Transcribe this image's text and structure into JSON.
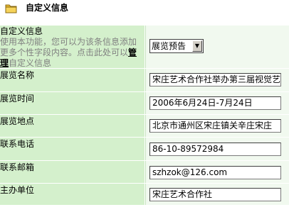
{
  "header": {
    "title": "自定义信息",
    "icon": "folder-icon"
  },
  "custom_info": {
    "label": "自定义信息",
    "desc_before": "使用本功能，您可以为该条信息添加更多个性字段内容。点击此处可以",
    "desc_link": "管理",
    "desc_after": "自定义信息",
    "select_value": "展览预告"
  },
  "fields": [
    {
      "label": "展览名称",
      "value": "宋庄艺术合作社举办第三届视觉艺"
    },
    {
      "label": "展览时间",
      "value": "2006年6月24日-7月24日"
    },
    {
      "label": "展览地点",
      "value": "北京市通州区宋庄镇关辛庄宋庄"
    },
    {
      "label": "联系电话",
      "value": "86-10-89572984"
    },
    {
      "label": "联系邮箱",
      "value": "szhzok@126.com"
    },
    {
      "label": "主办单位",
      "value": "宋庄艺术合作社"
    }
  ]
}
